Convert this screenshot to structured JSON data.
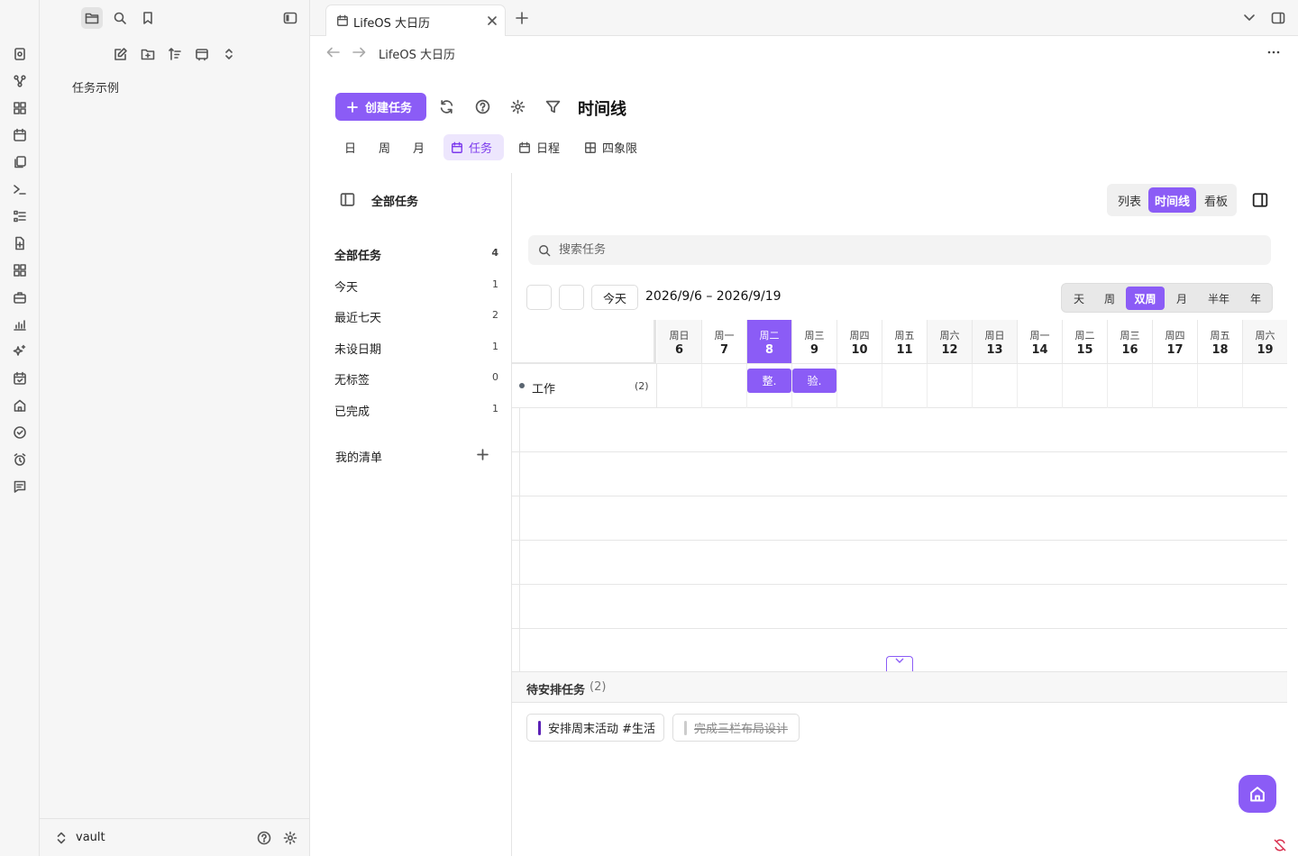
{
  "app": {
    "tab_title": "LifeOS 大日历",
    "breadcrumb_title": "LifeOS 大日历"
  },
  "file_panel": {
    "items": [
      "任务示例"
    ],
    "vault_name": "vault"
  },
  "toolbar": {
    "create_label": "创建任务",
    "view_title": "时间线"
  },
  "view_tabs": [
    {
      "label": "日"
    },
    {
      "label": "周"
    },
    {
      "label": "月"
    },
    {
      "label": "任务",
      "active": true
    },
    {
      "label": "日程"
    },
    {
      "label": "四象限"
    }
  ],
  "sidebar": {
    "title": "全部任务",
    "filters": [
      {
        "label": "全部任务",
        "count": "4"
      },
      {
        "label": "今天",
        "count": "1"
      },
      {
        "label": "最近七天",
        "count": "2"
      },
      {
        "label": "未设日期",
        "count": "1"
      },
      {
        "label": "无标签",
        "count": "0"
      },
      {
        "label": "已完成",
        "count": "1"
      }
    ],
    "my_lists_label": "我的清单"
  },
  "content": {
    "modes": [
      {
        "label": "列表"
      },
      {
        "label": "时间线",
        "active": true
      },
      {
        "label": "看板"
      }
    ],
    "search_placeholder": "搜索任务",
    "today_label": "今天",
    "range": "2026/9/6 – 2026/9/19",
    "scales": [
      {
        "label": "天"
      },
      {
        "label": "周"
      },
      {
        "label": "双周",
        "active": true
      },
      {
        "label": "月"
      },
      {
        "label": "半年"
      },
      {
        "label": "年"
      }
    ],
    "days": [
      {
        "wd": "周日",
        "d": "6"
      },
      {
        "wd": "周一",
        "d": "7"
      },
      {
        "wd": "周二",
        "d": "8"
      },
      {
        "wd": "周三",
        "d": "9"
      },
      {
        "wd": "周四",
        "d": "10"
      },
      {
        "wd": "周五",
        "d": "11"
      },
      {
        "wd": "周六",
        "d": "12"
      },
      {
        "wd": "周日",
        "d": "13"
      },
      {
        "wd": "周一",
        "d": "14"
      },
      {
        "wd": "周二",
        "d": "15"
      },
      {
        "wd": "周三",
        "d": "16"
      },
      {
        "wd": "周四",
        "d": "17"
      },
      {
        "wd": "周五",
        "d": "18"
      },
      {
        "wd": "周六",
        "d": "19"
      }
    ],
    "today_index": 2,
    "group": {
      "name": "工作",
      "count": "(2)"
    },
    "bars": [
      {
        "label": "整.",
        "day_index": 2
      },
      {
        "label": "验.",
        "day_index": 3
      }
    ],
    "unscheduled": {
      "title": "待安排任务",
      "count": "(2)",
      "items": [
        {
          "label": "安排周末活动 #生活",
          "color": "#5b21b6",
          "done": false
        },
        {
          "label": "完成三栏布局设计",
          "color": "#cccccc",
          "done": true
        }
      ]
    }
  },
  "colors": {
    "accent": "#8b5cf6",
    "accent_light": "#ede6fd"
  }
}
